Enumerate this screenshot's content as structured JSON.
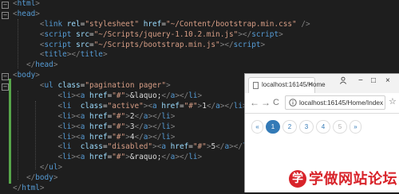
{
  "editor": {
    "lines": [
      {
        "parts": [
          [
            "t",
            "<"
          ],
          [
            "g",
            "html"
          ],
          [
            "t",
            ">"
          ]
        ]
      },
      {
        "parts": [
          [
            "t",
            "<"
          ],
          [
            "g",
            "head"
          ],
          [
            "t",
            ">"
          ]
        ]
      },
      {
        "parts": [
          [
            "x",
            "      "
          ],
          [
            "t",
            "<"
          ],
          [
            "g",
            "link"
          ],
          [
            "x",
            " "
          ],
          [
            "a",
            "rel"
          ],
          [
            "x",
            "="
          ],
          [
            "v",
            "\"stylesheet\""
          ],
          [
            "x",
            " "
          ],
          [
            "a",
            "href"
          ],
          [
            "x",
            "="
          ],
          [
            "v",
            "\"~/Content/bootstrap.min.css\""
          ],
          [
            "x",
            " "
          ],
          [
            "t",
            "/>"
          ]
        ]
      },
      {
        "parts": [
          [
            "x",
            "      "
          ],
          [
            "t",
            "<"
          ],
          [
            "g",
            "script"
          ],
          [
            "x",
            " "
          ],
          [
            "a",
            "src"
          ],
          [
            "x",
            "="
          ],
          [
            "v",
            "\"~/Scripts/jquery-1.10.2.min.js\""
          ],
          [
            "t",
            "></"
          ],
          [
            "g",
            "script"
          ],
          [
            "t",
            ">"
          ]
        ]
      },
      {
        "parts": [
          [
            "x",
            "      "
          ],
          [
            "t",
            "<"
          ],
          [
            "g",
            "script"
          ],
          [
            "x",
            " "
          ],
          [
            "a",
            "src"
          ],
          [
            "x",
            "="
          ],
          [
            "v",
            "\"~/Scripts/bootstrap.min.js\""
          ],
          [
            "t",
            "></"
          ],
          [
            "g",
            "script"
          ],
          [
            "t",
            ">"
          ]
        ]
      },
      {
        "parts": [
          [
            "x",
            "      "
          ],
          [
            "t",
            "<"
          ],
          [
            "g",
            "title"
          ],
          [
            "t",
            "></"
          ],
          [
            "g",
            "title"
          ],
          [
            "t",
            ">"
          ]
        ]
      },
      {
        "parts": [
          [
            "x",
            "   "
          ],
          [
            "t",
            "</"
          ],
          [
            "g",
            "head"
          ],
          [
            "t",
            ">"
          ]
        ]
      },
      {
        "parts": [
          [
            "t",
            "<"
          ],
          [
            "g",
            "body"
          ],
          [
            "t",
            ">"
          ]
        ]
      },
      {
        "parts": [
          [
            "x",
            "      "
          ],
          [
            "t",
            "<"
          ],
          [
            "g",
            "ul"
          ],
          [
            "x",
            " "
          ],
          [
            "a",
            "class"
          ],
          [
            "x",
            "="
          ],
          [
            "v",
            "\"pagination pager\""
          ],
          [
            "t",
            ">"
          ]
        ]
      },
      {
        "parts": [
          [
            "x",
            "          "
          ],
          [
            "t",
            "<"
          ],
          [
            "g",
            "li"
          ],
          [
            "t",
            "><"
          ],
          [
            "g",
            "a"
          ],
          [
            "x",
            " "
          ],
          [
            "a",
            "href"
          ],
          [
            "x",
            "="
          ],
          [
            "v",
            "\"#\""
          ],
          [
            "t",
            ">"
          ],
          [
            "x",
            "&laquo;"
          ],
          [
            "t",
            "</"
          ],
          [
            "g",
            "a"
          ],
          [
            "t",
            "></"
          ],
          [
            "g",
            "li"
          ],
          [
            "t",
            ">"
          ]
        ]
      },
      {
        "parts": [
          [
            "x",
            "          "
          ],
          [
            "t",
            "<"
          ],
          [
            "g",
            "li"
          ],
          [
            "x",
            "  "
          ],
          [
            "a",
            "class"
          ],
          [
            "x",
            "="
          ],
          [
            "v",
            "\"active\""
          ],
          [
            "t",
            "><"
          ],
          [
            "g",
            "a"
          ],
          [
            "x",
            " "
          ],
          [
            "a",
            "href"
          ],
          [
            "x",
            "="
          ],
          [
            "v",
            "\"#\""
          ],
          [
            "t",
            ">"
          ],
          [
            "x",
            "1"
          ],
          [
            "t",
            "</"
          ],
          [
            "g",
            "a"
          ],
          [
            "t",
            "></"
          ],
          [
            "g",
            "li"
          ],
          [
            "t",
            ">"
          ]
        ]
      },
      {
        "parts": [
          [
            "x",
            "          "
          ],
          [
            "t",
            "<"
          ],
          [
            "g",
            "li"
          ],
          [
            "t",
            "><"
          ],
          [
            "g",
            "a"
          ],
          [
            "x",
            " "
          ],
          [
            "a",
            "href"
          ],
          [
            "x",
            "="
          ],
          [
            "v",
            "\"#\""
          ],
          [
            "t",
            ">"
          ],
          [
            "x",
            "2"
          ],
          [
            "t",
            "</"
          ],
          [
            "g",
            "a"
          ],
          [
            "t",
            "></"
          ],
          [
            "g",
            "li"
          ],
          [
            "t",
            ">"
          ]
        ]
      },
      {
        "parts": [
          [
            "x",
            "          "
          ],
          [
            "t",
            "<"
          ],
          [
            "g",
            "li"
          ],
          [
            "t",
            "><"
          ],
          [
            "g",
            "a"
          ],
          [
            "x",
            " "
          ],
          [
            "a",
            "href"
          ],
          [
            "x",
            "="
          ],
          [
            "v",
            "\"#\""
          ],
          [
            "t",
            ">"
          ],
          [
            "x",
            "3"
          ],
          [
            "t",
            "</"
          ],
          [
            "g",
            "a"
          ],
          [
            "t",
            "></"
          ],
          [
            "g",
            "li"
          ],
          [
            "t",
            ">"
          ]
        ]
      },
      {
        "parts": [
          [
            "x",
            "          "
          ],
          [
            "t",
            "<"
          ],
          [
            "g",
            "li"
          ],
          [
            "t",
            "><"
          ],
          [
            "g",
            "a"
          ],
          [
            "x",
            " "
          ],
          [
            "a",
            "href"
          ],
          [
            "x",
            "="
          ],
          [
            "v",
            "\"#\""
          ],
          [
            "t",
            ">"
          ],
          [
            "x",
            "4"
          ],
          [
            "t",
            "</"
          ],
          [
            "g",
            "a"
          ],
          [
            "t",
            "></"
          ],
          [
            "g",
            "li"
          ],
          [
            "t",
            ">"
          ]
        ]
      },
      {
        "parts": [
          [
            "x",
            "          "
          ],
          [
            "t",
            "<"
          ],
          [
            "g",
            "li"
          ],
          [
            "x",
            "  "
          ],
          [
            "a",
            "class"
          ],
          [
            "x",
            "="
          ],
          [
            "v",
            "\"disabled\""
          ],
          [
            "t",
            "><"
          ],
          [
            "g",
            "a"
          ],
          [
            "x",
            " "
          ],
          [
            "a",
            "href"
          ],
          [
            "x",
            "="
          ],
          [
            "v",
            "\"#\""
          ],
          [
            "t",
            ">"
          ],
          [
            "x",
            "5"
          ],
          [
            "t",
            "</"
          ],
          [
            "g",
            "a"
          ],
          [
            "t",
            "></"
          ],
          [
            "g",
            "li"
          ],
          [
            "t",
            ">"
          ]
        ]
      },
      {
        "parts": [
          [
            "x",
            "          "
          ],
          [
            "t",
            "<"
          ],
          [
            "g",
            "li"
          ],
          [
            "t",
            "><"
          ],
          [
            "g",
            "a"
          ],
          [
            "x",
            " "
          ],
          [
            "a",
            "href"
          ],
          [
            "x",
            "="
          ],
          [
            "v",
            "\"#\""
          ],
          [
            "t",
            ">"
          ],
          [
            "x",
            "&raquo;"
          ],
          [
            "t",
            "</"
          ],
          [
            "g",
            "a"
          ],
          [
            "t",
            "></"
          ],
          [
            "g",
            "li"
          ],
          [
            "t",
            ">"
          ]
        ]
      },
      {
        "parts": [
          [
            "x",
            "      "
          ],
          [
            "t",
            "</"
          ],
          [
            "g",
            "ul"
          ],
          [
            "t",
            ">"
          ]
        ]
      },
      {
        "parts": [
          [
            "x",
            "   "
          ],
          [
            "t",
            "</"
          ],
          [
            "g",
            "body"
          ],
          [
            "t",
            ">"
          ]
        ]
      },
      {
        "parts": [
          [
            "t",
            "</"
          ],
          [
            "g",
            "html"
          ],
          [
            "t",
            ">"
          ]
        ]
      }
    ],
    "fold_markers": [
      "−",
      "−",
      "−",
      "−"
    ],
    "colors": {
      "background": "#1e1e1e",
      "tag": "#569cd6",
      "attribute": "#9cdcfe",
      "value": "#d69d85",
      "bracket": "#808080",
      "text": "#dcdcdc",
      "change_bar": "#57a64a"
    }
  },
  "browser": {
    "tab_title": "localhost:16145/Home",
    "tab_close": "×",
    "user_icon": "user-icon",
    "controls": {
      "minimize": "−",
      "maximize": "□",
      "close": "×"
    },
    "nav": {
      "back": "←",
      "forward": "→",
      "reload": "C"
    },
    "address": "localhost:16145/Home/Index",
    "star": "☆",
    "pagination": [
      {
        "label": "«",
        "state": "normal"
      },
      {
        "label": "1",
        "state": "active"
      },
      {
        "label": "2",
        "state": "normal"
      },
      {
        "label": "3",
        "state": "normal"
      },
      {
        "label": "4",
        "state": "normal"
      },
      {
        "label": "5",
        "state": "disabled"
      },
      {
        "label": "»",
        "state": "normal"
      }
    ],
    "colors": {
      "primary": "#337ab7",
      "disabled": "#aaaaaa",
      "border": "#dddddd"
    }
  },
  "watermark": {
    "logo_char": "学",
    "text": "学做网站论坛",
    "color": "#d8232a"
  }
}
